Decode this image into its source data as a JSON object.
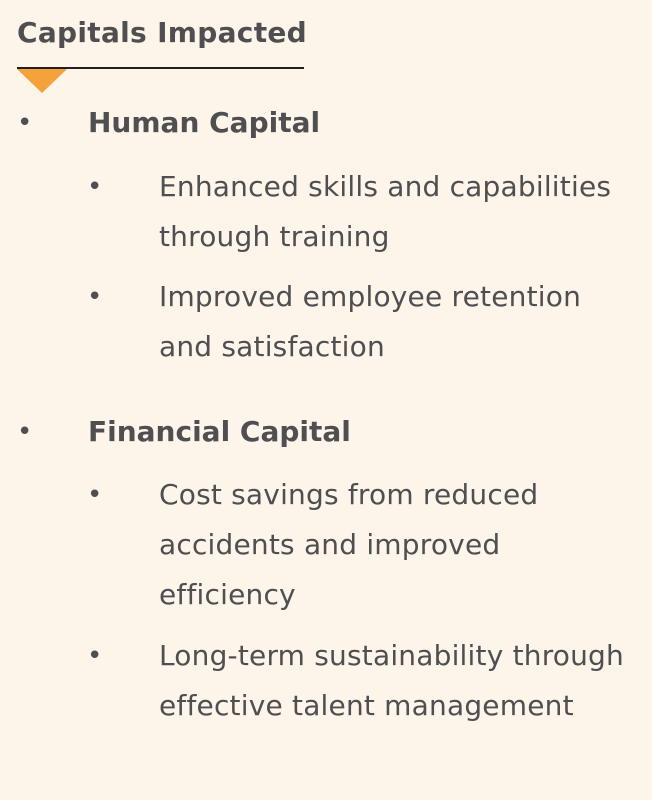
{
  "heading": "Capitals Impacted",
  "sections": [
    {
      "title": "Human Capital",
      "items": [
        "Enhanced skills and capabilities through training",
        "Improved employee retention and satisfaction"
      ]
    },
    {
      "title": "Financial Capital",
      "items": [
        "Cost savings from reduced accidents and improved efficiency",
        "Long-term sustainability through effective talent management"
      ]
    }
  ],
  "bullet_glyph": "•",
  "colors": {
    "background": "#fdf4ea",
    "text": "#4f4f52",
    "accent": "#f6a23a",
    "rule": "#1f1f1f"
  }
}
